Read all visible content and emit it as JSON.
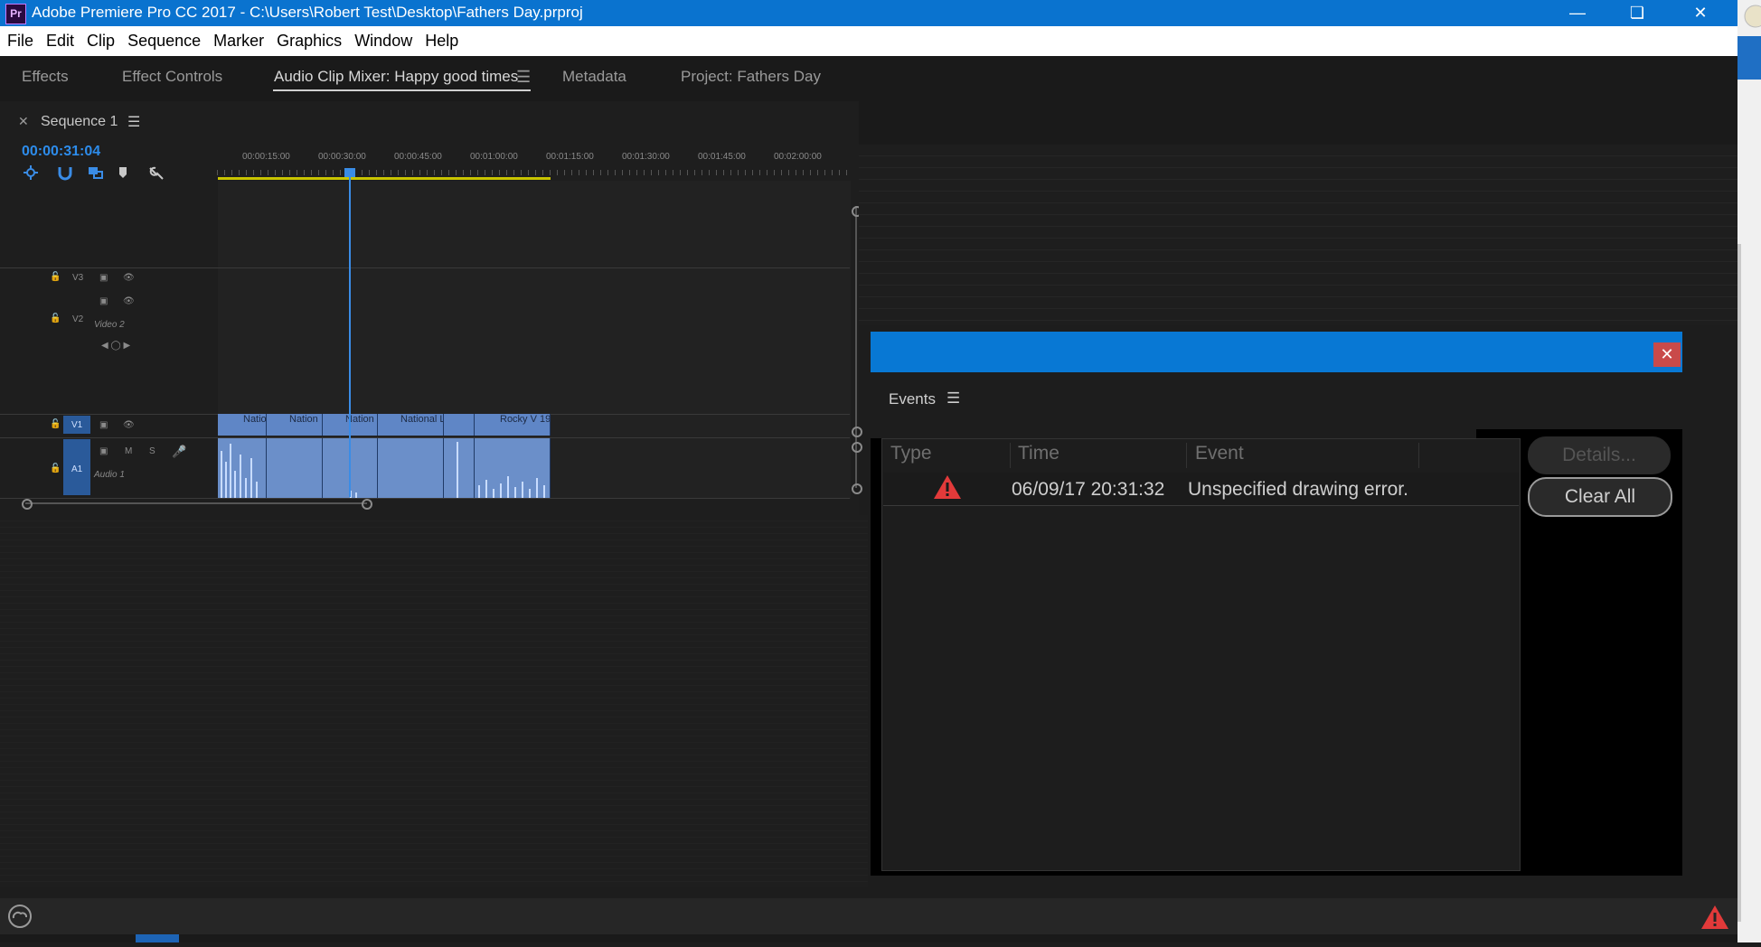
{
  "app": {
    "logo": "Pr",
    "title": "Adobe Premiere Pro CC 2017 - C:\\Users\\Robert Test\\Desktop\\Fathers Day.prproj"
  },
  "menu": [
    "File",
    "Edit",
    "Clip",
    "Sequence",
    "Marker",
    "Graphics",
    "Window",
    "Help"
  ],
  "panel_tabs": {
    "effects": "Effects",
    "effect_controls": "Effect Controls",
    "audio_clip_mixer": "Audio Clip Mixer: Happy good times",
    "metadata": "Metadata",
    "project": "Project: Fathers Day"
  },
  "sequence": {
    "name": "Sequence 1",
    "timecode": "00:00:31:04",
    "ruler": [
      "00:00:15:00",
      "00:00:30:00",
      "00:00:45:00",
      "00:01:00:00",
      "00:01:15:00",
      "00:01:30:00",
      "00:01:45:00",
      "00:02:00:00"
    ],
    "tracks": {
      "v3": "V3",
      "v2": "V2",
      "v2_name": "Video 2",
      "v1": "V1",
      "a1": "A1",
      "a1_name": "Audio 1",
      "m": "M",
      "s": "S"
    },
    "clips": [
      "Natio",
      "Nation",
      "Nation",
      "National L",
      "",
      "Rocky V 19"
    ]
  },
  "events": {
    "title": "Events",
    "columns": {
      "type": "Type",
      "time": "Time",
      "event": "Event"
    },
    "rows": [
      {
        "type": "warning-icon",
        "time": "06/09/17 20:31:32",
        "event": "Unspecified drawing error."
      }
    ],
    "details_label": "Details...",
    "clear_all_label": "Clear All"
  },
  "colors": {
    "accent_blue": "#0a73cf",
    "timecode_blue": "#2d8ceb",
    "warning_red": "#e23a3a",
    "clip_blue": "#6b8fc9"
  }
}
